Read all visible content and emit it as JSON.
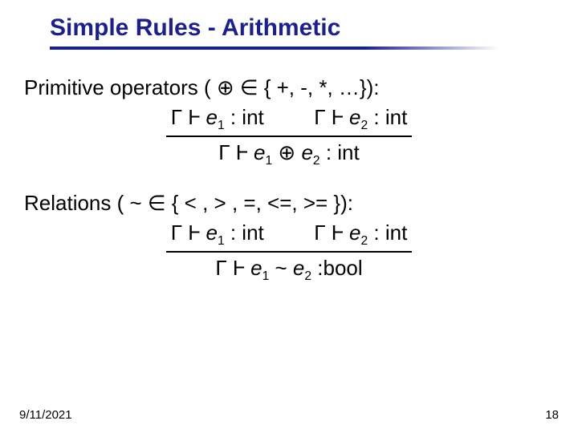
{
  "title": "Simple Rules - Arithmetic",
  "section1": {
    "heading": "Primitive operators ( ⊕ ∈ { +, -, *, …}):",
    "prem1_pre": "Γ Ⱶ ",
    "prem1_e": "e",
    "prem1_sub": "1",
    "prem1_post": " : int",
    "prem2_pre": "Γ Ⱶ ",
    "prem2_e": "e",
    "prem2_sub": "2",
    "prem2_post": " : int",
    "conc_pre": "Γ Ⱶ ",
    "conc_e1": "e",
    "conc_sub1": "1",
    "conc_op": " ⊕ ",
    "conc_e2": "e",
    "conc_sub2": "2",
    "conc_post": " : int"
  },
  "section2": {
    "heading": "Relations ( ~ ∈ { < , > , =, <=, >= }):",
    "prem1_pre": "Γ Ⱶ ",
    "prem1_e": "e",
    "prem1_sub": "1",
    "prem1_post": " : int",
    "prem2_pre": "Γ Ⱶ ",
    "prem2_e": "e",
    "prem2_sub": "2",
    "prem2_post": " : int",
    "conc_pre": "Γ Ⱶ ",
    "conc_e1": "e",
    "conc_sub1": "1",
    "conc_op": " ~  ",
    "conc_e2": "e",
    "conc_sub2": "2",
    "conc_post": " :bool"
  },
  "footer": {
    "date": "9/11/2021",
    "page": "18"
  }
}
